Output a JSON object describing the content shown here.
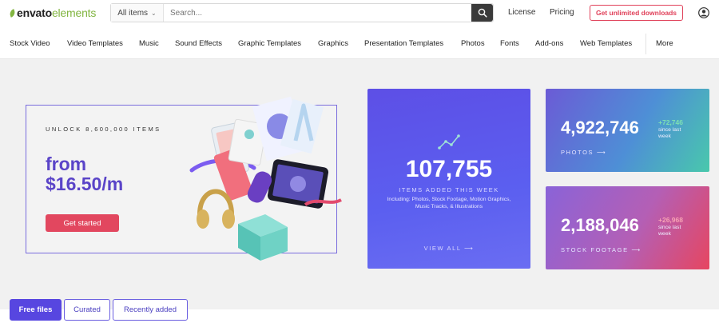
{
  "header": {
    "logo": {
      "part1": "envato",
      "part2": "elements"
    },
    "search": {
      "category": "All items",
      "placeholder": "Search..."
    },
    "links": {
      "license": "License",
      "pricing": "Pricing"
    },
    "cta": "Get unlimited downloads"
  },
  "nav": {
    "categories": [
      "Stock Video",
      "Video Templates",
      "Music",
      "Sound Effects",
      "Graphic Templates",
      "Graphics",
      "Presentation Templates",
      "Photos",
      "Fonts",
      "Add-ons",
      "Web Templates"
    ],
    "more": "More"
  },
  "promo": {
    "kicker": "UNLOCK 8,600,000 ITEMS",
    "price_line1": "from",
    "price_line2": "$16.50/m",
    "button": "Get started"
  },
  "stats": {
    "weekly": {
      "number": "107,755",
      "label": "ITEMS ADDED THIS WEEK",
      "description": "Including: Photos, Stock Footage, Motion Graphics, Music Tracks, & Illustrations",
      "link": "VIEW ALL ⟶"
    },
    "photos": {
      "number": "4,922,746",
      "delta": "+72,746",
      "since": "since last week",
      "label": "PHOTOS ⟶"
    },
    "footage": {
      "number": "2,188,046",
      "delta": "+26,968",
      "since": "since last week",
      "label": "STOCK FOOTAGE ⟶"
    }
  },
  "tabs": [
    "Free files",
    "Curated",
    "Recently added"
  ],
  "colors": {
    "brand_green": "#82b541",
    "accent_purple": "#5746e0",
    "cta_red": "#e0415a"
  }
}
